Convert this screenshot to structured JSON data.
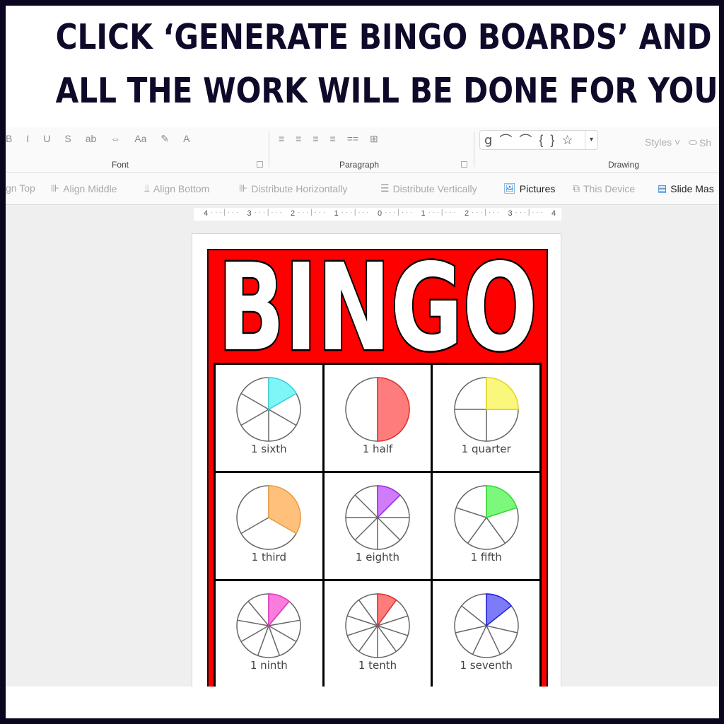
{
  "banner": {
    "line1": "CLICK ‘GENERATE BINGO BOARDS’ AND",
    "line2": "ALL THE WORK WILL BE DONE FOR YOU!"
  },
  "ribbon": {
    "font_group": {
      "label": "Font",
      "icons": [
        "bold-icon",
        "italic-icon",
        "underline-icon",
        "shadow-icon",
        "strikethrough-icon",
        "character-spacing-icon",
        "change-case-icon",
        "highlight-color-icon",
        "font-color-icon"
      ],
      "glyphs": [
        "B",
        "I",
        "U",
        "S",
        "ab",
        "⇔",
        "Aa",
        "✎",
        "A"
      ]
    },
    "paragraph_group": {
      "label": "Paragraph",
      "icons": [
        "align-left-icon",
        "align-center-icon",
        "align-right-icon",
        "justify-icon",
        "columns-icon",
        "text-direction-icon"
      ],
      "glyphs": [
        "≡",
        "≡",
        "≡",
        "≡",
        "==",
        "⊞"
      ]
    },
    "drawing_group": {
      "label": "Drawing",
      "shapes": [
        "ց",
        "⌒",
        "⌒",
        "{",
        "}",
        "☆"
      ],
      "shapes_names": [
        "freeform-icon",
        "arc-icon",
        "curve-icon",
        "left-brace-icon",
        "right-brace-icon",
        "star-icon"
      ],
      "styles_label": "Styles",
      "shape_fill_label": "Sh"
    }
  },
  "toolbar2": {
    "items": [
      {
        "label": "gn Top",
        "icon": "align-top-icon",
        "glyph": "",
        "active": false
      },
      {
        "label": "Align Middle",
        "icon": "align-middle-icon",
        "glyph": "⊪",
        "active": false
      },
      {
        "label": "Align Bottom",
        "icon": "align-bottom-icon",
        "glyph": "⫫",
        "active": false
      },
      {
        "label": "Distribute Horizontally",
        "icon": "distribute-horizontally-icon",
        "glyph": "⊪",
        "active": false
      },
      {
        "label": "Distribute Vertically",
        "icon": "distribute-vertically-icon",
        "glyph": "☰",
        "active": false
      },
      {
        "label": "Pictures",
        "icon": "pictures-icon",
        "glyph": "🖼",
        "active": true
      },
      {
        "label": "This Device",
        "icon": "this-device-icon",
        "glyph": "⧉",
        "active": false
      },
      {
        "label": "Slide Mas",
        "icon": "slide-master-icon",
        "glyph": "▤",
        "active": true
      }
    ]
  },
  "ruler": {
    "labels": [
      "4",
      "3",
      "2",
      "1",
      "0",
      "1",
      "2",
      "3",
      "4"
    ]
  },
  "bingo_card": {
    "title": "BINGO",
    "background": "#ff0000",
    "cells": [
      {
        "label": "1 sixth",
        "denominator": 6,
        "color": "#7ff5f8",
        "stroke": "#33d6dd"
      },
      {
        "label": "1 half",
        "denominator": 2,
        "color": "#ff7c7c",
        "stroke": "#e33030"
      },
      {
        "label": "1 quarter",
        "denominator": 4,
        "color": "#fbf77c",
        "stroke": "#e6dc22"
      },
      {
        "label": "1 third",
        "denominator": 3,
        "color": "#ffc07c",
        "stroke": "#f0a040"
      },
      {
        "label": "1 eighth",
        "denominator": 8,
        "color": "#d07cfa",
        "stroke": "#9a2ee0"
      },
      {
        "label": "1 fifth",
        "denominator": 5,
        "color": "#7cf87c",
        "stroke": "#33dd33"
      },
      {
        "label": "1 ninth",
        "denominator": 9,
        "color": "#fa7cdc",
        "stroke": "#e633c0"
      },
      {
        "label": "1 tenth",
        "denominator": 10,
        "color": "#ff7c7c",
        "stroke": "#e33030"
      },
      {
        "label": "1 seventh",
        "denominator": 7,
        "color": "#7c7cf8",
        "stroke": "#2020e0"
      }
    ]
  }
}
